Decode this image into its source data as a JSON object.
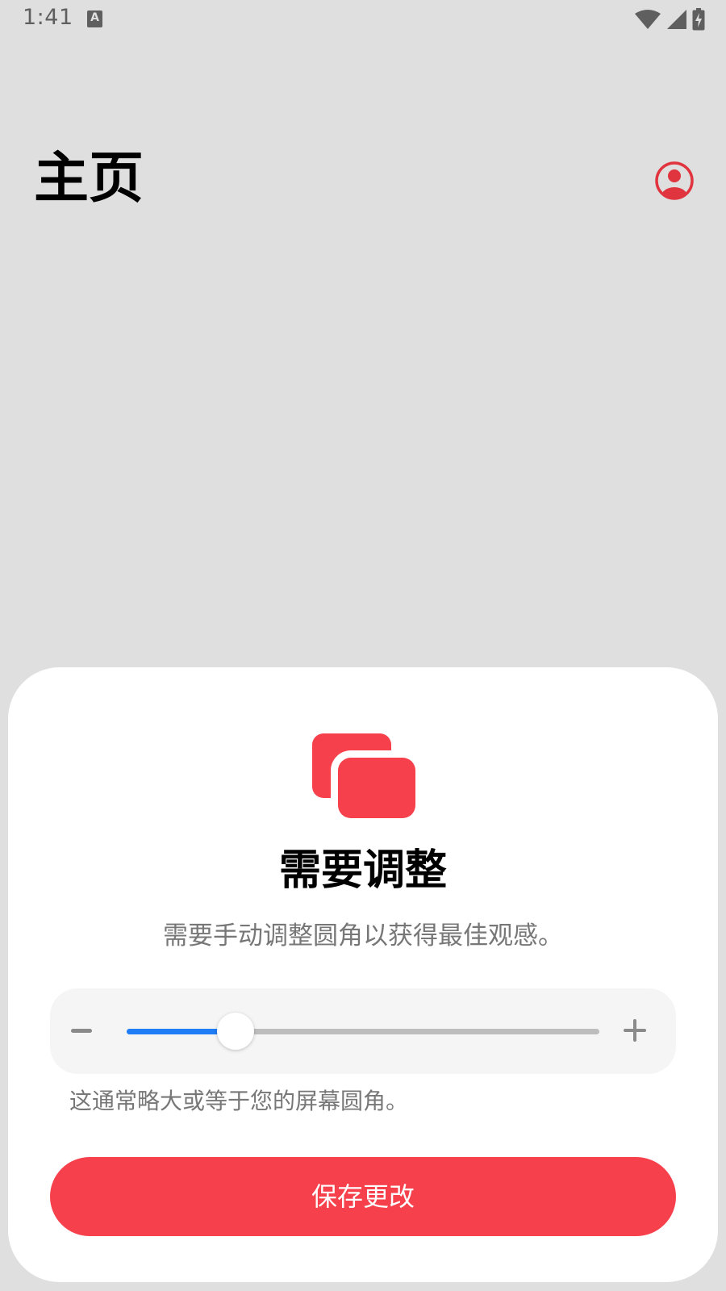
{
  "status_bar": {
    "time": "1:41",
    "notification_icon": "a-icon",
    "notification_glyph": "A",
    "icons": [
      "wifi-icon",
      "cellular-signal-icon",
      "battery-charging-icon"
    ]
  },
  "header": {
    "title": "主页",
    "account_icon": "account-circle-icon"
  },
  "sheet": {
    "icon": "rounded-corners-icon",
    "title": "需要调整",
    "description": "需要手动调整圆角以获得最佳观感。",
    "slider": {
      "value_fraction": 0.23,
      "decrease_icon": "minus-icon",
      "increase_icon": "plus-icon"
    },
    "hint": "这通常略大或等于您的屏幕圆角。",
    "save_label": "保存更改"
  },
  "colors": {
    "accent": "#f6404b",
    "slider_active": "#1f7df5",
    "background": "#dfdfdf",
    "sheet": "#ffffff"
  }
}
